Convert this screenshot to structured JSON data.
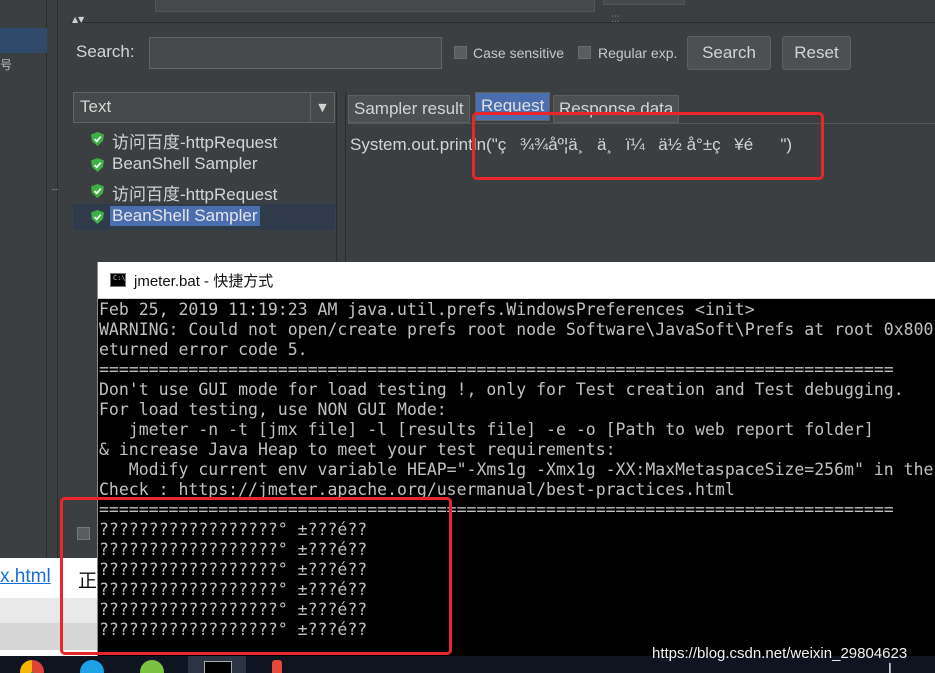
{
  "jmeter": {
    "search": {
      "label": "Search:",
      "value": "",
      "case_sensitive_label": "Case sensitive",
      "regular_exp_label": "Regular exp.",
      "search_button": "Search",
      "reset_button": "Reset"
    },
    "renderer": {
      "selected": "Text"
    },
    "tree": [
      {
        "label": "访问百度-httpRequest",
        "status": "success",
        "selected": false
      },
      {
        "label": "BeanShell Sampler",
        "status": "success",
        "selected": false
      },
      {
        "label": "访问百度-httpRequest",
        "status": "success",
        "selected": false
      },
      {
        "label": "BeanShell Sampler",
        "status": "success",
        "selected": true
      }
    ],
    "tabs": [
      {
        "label": "Sampler result",
        "active": false
      },
      {
        "label": "Request",
        "active": true
      },
      {
        "label": "Response data",
        "active": false
      }
    ],
    "request_content": "System.out.println(\"ç¾¾åº¦ä¸ä¸ï¼ä½ å°±ç¥é\")",
    "left_glyph": "号"
  },
  "console": {
    "title": "jmeter.bat - 快捷方式",
    "lines": [
      "Feb 25, 2019 11:19:23 AM java.util.prefs.WindowsPreferences <init>",
      "WARNING: Could not open/create prefs root node Software\\JavaSoft\\Prefs at root 0x800",
      "eturned error code 5.",
      "================================================================================",
      "Don't use GUI mode for load testing !, only for Test creation and Test debugging.",
      "For load testing, use NON GUI Mode:",
      "   jmeter -n -t [jmx file] -l [results file] -e -o [Path to web report folder]",
      "& increase Java Heap to meet your test requirements:",
      "   Modify current env variable HEAP=\"-Xms1g -Xmx1g -XX:MaxMetaspaceSize=256m\" in the",
      "Check : https://jmeter.apache.org/usermanual/best-practices.html",
      "================================================================================",
      "??????????????????° ±???é??",
      "??????????????????° ±???é??",
      "??????????????????° ±???é??",
      "??????????????????° ±???é??",
      "??????????????????° ±???é??",
      "??????????????????° ±???é??"
    ]
  },
  "browser_fragment": {
    "link_text": "x.html",
    "char_text": "正"
  },
  "watermark": "https://blog.csdn.net/weixin_29804623",
  "taskbar_icons": [
    "chrome-icon",
    "ie-icon",
    "wechat-icon",
    "cmd-icon",
    "paint-icon"
  ],
  "colors": {
    "annotation_red": "#e8262b",
    "jmeter_bg": "#3c3f41",
    "selection_blue": "#4b6eaf",
    "console_bg": "#000000"
  }
}
